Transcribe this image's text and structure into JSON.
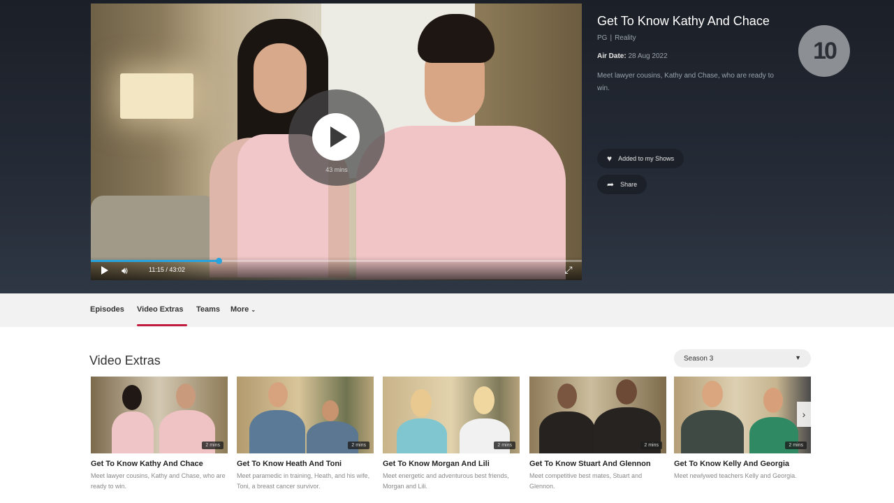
{
  "player": {
    "duration_badge": "43 mins",
    "time": "11:15 / 43:02",
    "progress_fraction": 0.261
  },
  "info": {
    "title": "Get To Know Kathy And Chace",
    "rating": "PG",
    "separator": "|",
    "genre": "Reality",
    "air_date_label": "Air Date:",
    "air_date_value": "28 Aug 2022",
    "description": "Meet lawyer cousins, Kathy and Chase, who are ready to win."
  },
  "actions": {
    "my_shows_label": "Added to my Shows",
    "share_label": "Share"
  },
  "logo": {
    "text": "10"
  },
  "tabs": [
    {
      "label": "Episodes",
      "active": false
    },
    {
      "label": "Video Extras",
      "active": true
    },
    {
      "label": "Teams",
      "active": false
    },
    {
      "label": "More",
      "active": false
    }
  ],
  "section": {
    "title": "Video Extras",
    "season": "Season 3"
  },
  "cards": [
    {
      "title": "Get To Know Kathy And Chace",
      "desc": "Meet lawyer cousins, Kathy and Chase, who are ready to win.",
      "duration": "2 mins"
    },
    {
      "title": "Get To Know Heath And Toni",
      "desc": "Meet paramedic in training, Heath, and his wife, Toni, a breast cancer survivor.",
      "duration": "2 mins"
    },
    {
      "title": "Get To Know Morgan And Lili",
      "desc": "Meet energetic and adventurous best friends, Morgan and Lili.",
      "duration": "2 mins"
    },
    {
      "title": "Get To Know Stuart And Glennon",
      "desc": "Meet competitive best mates, Stuart and Glennon.",
      "duration": "2 mins"
    },
    {
      "title": "Get To Know Kelly And Georgia",
      "desc": "Meet newlywed teachers Kelly and Georgia.",
      "duration": "2 mins"
    }
  ],
  "colors": {
    "accent": "#c21d3f",
    "progress": "#27a4de"
  }
}
